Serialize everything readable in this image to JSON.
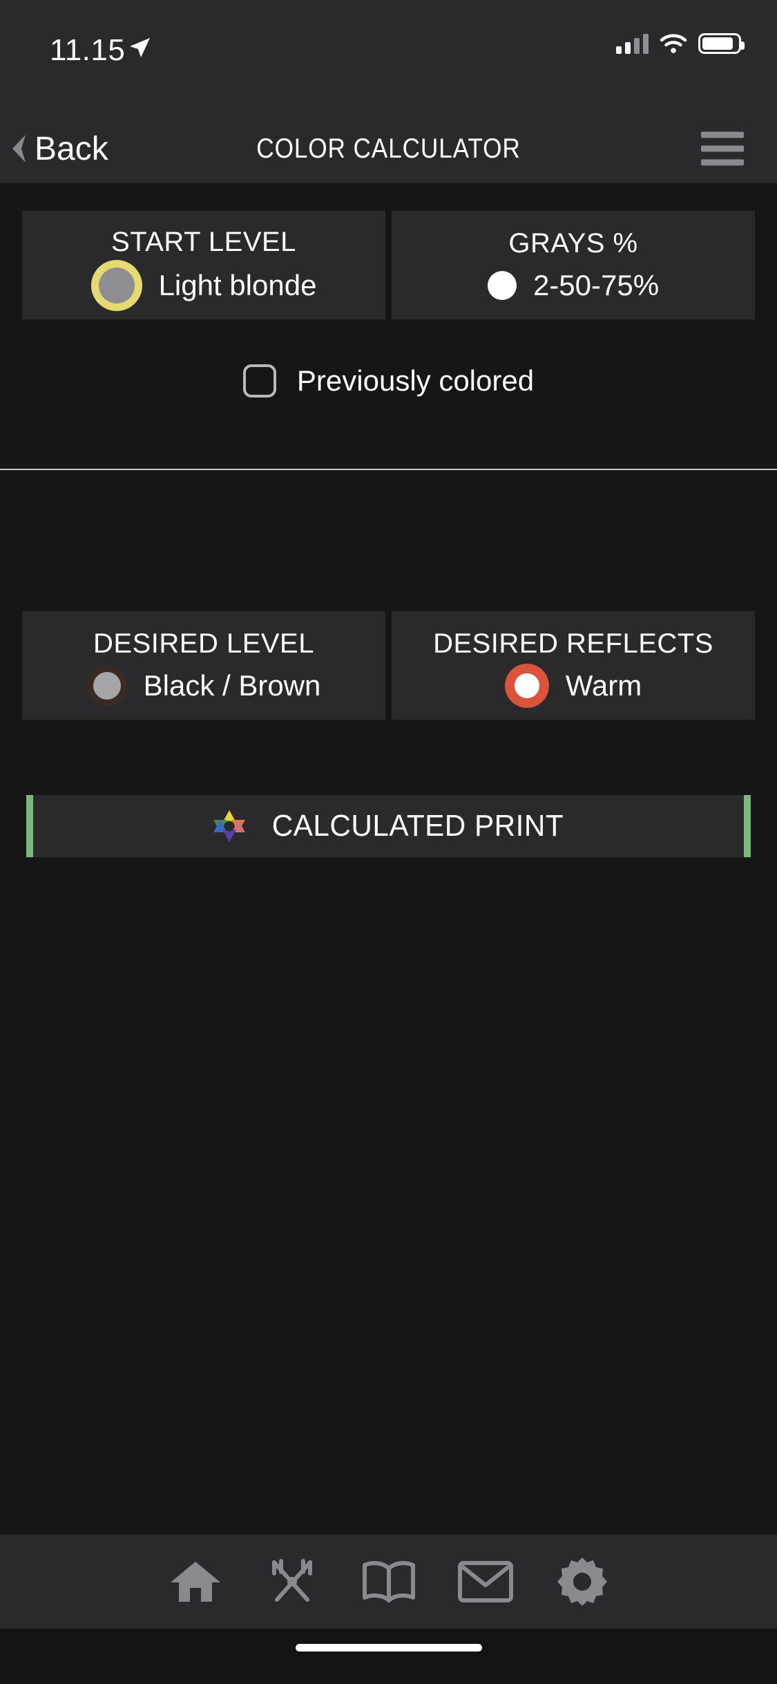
{
  "statusbar": {
    "time": "11.15",
    "location_icon": "location-arrow-icon",
    "cellular_icon": "cellular-signal-icon",
    "wifi_icon": "wifi-icon",
    "battery_icon": "battery-icon"
  },
  "navbar": {
    "back_label": "Back",
    "back_icon": "chevron-left-icon",
    "title": "COLOR CALCULATOR",
    "menu_icon": "hamburger-menu-icon"
  },
  "upper_section": {
    "cards": [
      {
        "title": "START LEVEL",
        "value": "Light blonde",
        "swatch_name": "start-level-color-swatch",
        "swatch_ring": "#e5da72",
        "swatch_center": "#8e8e93"
      },
      {
        "title": "GRAYS %",
        "value": "2-50-75%",
        "swatch_name": "grays-percent-swatch",
        "swatch_ring": "#ffffff",
        "swatch_center": "#ffffff"
      }
    ],
    "checkbox": {
      "label": "Previously colored",
      "checked": false
    }
  },
  "lower_section": {
    "cards": [
      {
        "title": "DESIRED LEVEL",
        "value": "Black / Brown",
        "swatch_name": "desired-level-color-swatch",
        "swatch_ring": "#3a2a22",
        "swatch_center": "#a6a6a8"
      },
      {
        "title": "DESIRED REFLECTS",
        "value": "Warm",
        "swatch_name": "desired-reflects-color-swatch",
        "swatch_ring": "#d9543a",
        "swatch_center": "#ffffff"
      }
    ],
    "calculated_print": {
      "label": "CALCULATED PRINT",
      "icon": "color-star-icon",
      "accent_color": "#7cb87c"
    }
  },
  "tabbar": {
    "items": [
      {
        "icon": "home-icon",
        "label": "Home"
      },
      {
        "icon": "scissors-icon",
        "label": "Tools"
      },
      {
        "icon": "book-icon",
        "label": "Book"
      },
      {
        "icon": "mail-icon",
        "label": "Mail"
      },
      {
        "icon": "gear-icon",
        "label": "Settings"
      }
    ],
    "icon_color": "#8a8a8e"
  },
  "home_indicator": "home-indicator-bar"
}
